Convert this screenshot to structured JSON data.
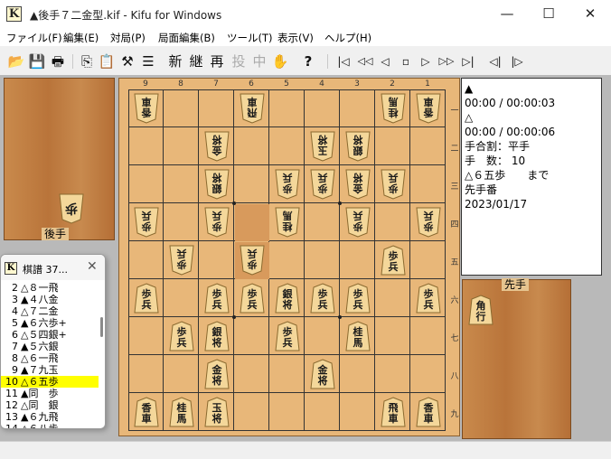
{
  "window": {
    "icon": "K",
    "title": "▲後手７二金型.kif - Kifu for Windows",
    "minimize": "—",
    "maximize": "☐",
    "close": "✕"
  },
  "menu": [
    "ファイル(F)",
    "編集(E)",
    "対局(P)",
    "局面編集(B)",
    "ツール(T)",
    "表示(V)",
    "ヘルプ(H)"
  ],
  "toolbar": {
    "open": "📂",
    "save": "💾",
    "print": "🖶",
    "copy": "⎘",
    "paste": "📋",
    "tool": "⚒",
    "list": "☰",
    "new_label": "新",
    "continue_label": "継",
    "replay_label": "再",
    "resign_label": "投",
    "pause_label": "中",
    "hand": "✋",
    "help": "?",
    "first": "|◁",
    "back10": "◁◁",
    "back": "◁",
    "stop": "▫",
    "forward": "▷",
    "forward10": "▷▷",
    "last": "▷|",
    "branch_prev": "◁|",
    "branch_next": "|▷"
  },
  "board": {
    "files": [
      "9",
      "8",
      "7",
      "6",
      "5",
      "4",
      "3",
      "2",
      "1"
    ],
    "ranks": [
      "一",
      "二",
      "三",
      "四",
      "五",
      "六",
      "七",
      "八",
      "九"
    ],
    "highlight": [
      {
        "file": 6,
        "rank": 4
      },
      {
        "file": 6,
        "rank": 5
      }
    ],
    "pieces": [
      {
        "file": 9,
        "rank": 1,
        "owner": "gote",
        "label": "香車"
      },
      {
        "file": 6,
        "rank": 1,
        "owner": "gote",
        "label": "飛車"
      },
      {
        "file": 2,
        "rank": 1,
        "owner": "gote",
        "label": "桂馬"
      },
      {
        "file": 1,
        "rank": 1,
        "owner": "gote",
        "label": "香車"
      },
      {
        "file": 7,
        "rank": 2,
        "owner": "gote",
        "label": "金将"
      },
      {
        "file": 4,
        "rank": 2,
        "owner": "gote",
        "label": "玉将"
      },
      {
        "file": 3,
        "rank": 2,
        "owner": "gote",
        "label": "銀将"
      },
      {
        "file": 7,
        "rank": 3,
        "owner": "gote",
        "label": "銀将"
      },
      {
        "file": 5,
        "rank": 3,
        "owner": "gote",
        "label": "歩兵"
      },
      {
        "file": 4,
        "rank": 3,
        "owner": "gote",
        "label": "歩兵"
      },
      {
        "file": 3,
        "rank": 3,
        "owner": "gote",
        "label": "金将"
      },
      {
        "file": 2,
        "rank": 3,
        "owner": "gote",
        "label": "歩兵"
      },
      {
        "file": 9,
        "rank": 4,
        "owner": "gote",
        "label": "歩兵"
      },
      {
        "file": 7,
        "rank": 4,
        "owner": "gote",
        "label": "歩兵"
      },
      {
        "file": 5,
        "rank": 4,
        "owner": "gote",
        "label": "桂馬"
      },
      {
        "file": 3,
        "rank": 4,
        "owner": "gote",
        "label": "歩兵"
      },
      {
        "file": 1,
        "rank": 4,
        "owner": "gote",
        "label": "歩兵"
      },
      {
        "file": 8,
        "rank": 5,
        "owner": "gote",
        "label": "歩兵"
      },
      {
        "file": 6,
        "rank": 5,
        "owner": "gote",
        "label": "歩兵"
      },
      {
        "file": 2,
        "rank": 5,
        "owner": "sente",
        "label": "歩兵"
      },
      {
        "file": 9,
        "rank": 6,
        "owner": "sente",
        "label": "歩兵"
      },
      {
        "file": 7,
        "rank": 6,
        "owner": "sente",
        "label": "歩兵"
      },
      {
        "file": 6,
        "rank": 6,
        "owner": "sente",
        "label": "歩兵"
      },
      {
        "file": 5,
        "rank": 6,
        "owner": "sente",
        "label": "銀将"
      },
      {
        "file": 4,
        "rank": 6,
        "owner": "sente",
        "label": "歩兵"
      },
      {
        "file": 3,
        "rank": 6,
        "owner": "sente",
        "label": "歩兵"
      },
      {
        "file": 1,
        "rank": 6,
        "owner": "sente",
        "label": "歩兵"
      },
      {
        "file": 8,
        "rank": 7,
        "owner": "sente",
        "label": "歩兵"
      },
      {
        "file": 7,
        "rank": 7,
        "owner": "sente",
        "label": "銀将"
      },
      {
        "file": 5,
        "rank": 7,
        "owner": "sente",
        "label": "歩兵"
      },
      {
        "file": 3,
        "rank": 7,
        "owner": "sente",
        "label": "桂馬"
      },
      {
        "file": 7,
        "rank": 8,
        "owner": "sente",
        "label": "金将"
      },
      {
        "file": 4,
        "rank": 8,
        "owner": "sente",
        "label": "金将"
      },
      {
        "file": 9,
        "rank": 9,
        "owner": "sente",
        "label": "香車"
      },
      {
        "file": 8,
        "rank": 9,
        "owner": "sente",
        "label": "桂馬"
      },
      {
        "file": 7,
        "rank": 9,
        "owner": "sente",
        "label": "玉将"
      },
      {
        "file": 2,
        "rank": 9,
        "owner": "sente",
        "label": "飛車"
      },
      {
        "file": 1,
        "rank": 9,
        "owner": "sente",
        "label": "香車"
      }
    ]
  },
  "gote_stand": {
    "label": "後手",
    "pieces": [
      {
        "label": "歩"
      }
    ]
  },
  "sente_stand": {
    "label": "先手",
    "pieces": [
      {
        "label": "角行"
      }
    ]
  },
  "info": {
    "lines": [
      "▲",
      "00:00 / 00:00:03",
      "△",
      "00:00 / 00:00:06",
      "手合割：平手",
      "手　数： 10",
      "△６五歩　　まで",
      "先手番",
      "2023/01/17"
    ]
  },
  "kifu_window": {
    "icon": "K",
    "title": "棋譜 37...",
    "close": "✕",
    "moves": [
      {
        "num": "2",
        "text": "△８一飛",
        "selected": false
      },
      {
        "num": "3",
        "text": "▲４八金",
        "selected": false
      },
      {
        "num": "4",
        "text": "△７二金",
        "selected": false
      },
      {
        "num": "5",
        "text": "▲６六歩+",
        "selected": false
      },
      {
        "num": "6",
        "text": "△５四銀+",
        "selected": false
      },
      {
        "num": "7",
        "text": "▲５六銀",
        "selected": false
      },
      {
        "num": "8",
        "text": "△６一飛",
        "selected": false
      },
      {
        "num": "9",
        "text": "▲７九玉",
        "selected": false
      },
      {
        "num": "10",
        "text": "△６五歩",
        "selected": true
      },
      {
        "num": "11",
        "text": "▲同　歩",
        "selected": false
      },
      {
        "num": "12",
        "text": "△同　銀",
        "selected": false
      },
      {
        "num": "13",
        "text": "▲６九飛",
        "selected": false
      },
      {
        "num": "14",
        "text": "△６八歩",
        "selected": false
      }
    ]
  }
}
